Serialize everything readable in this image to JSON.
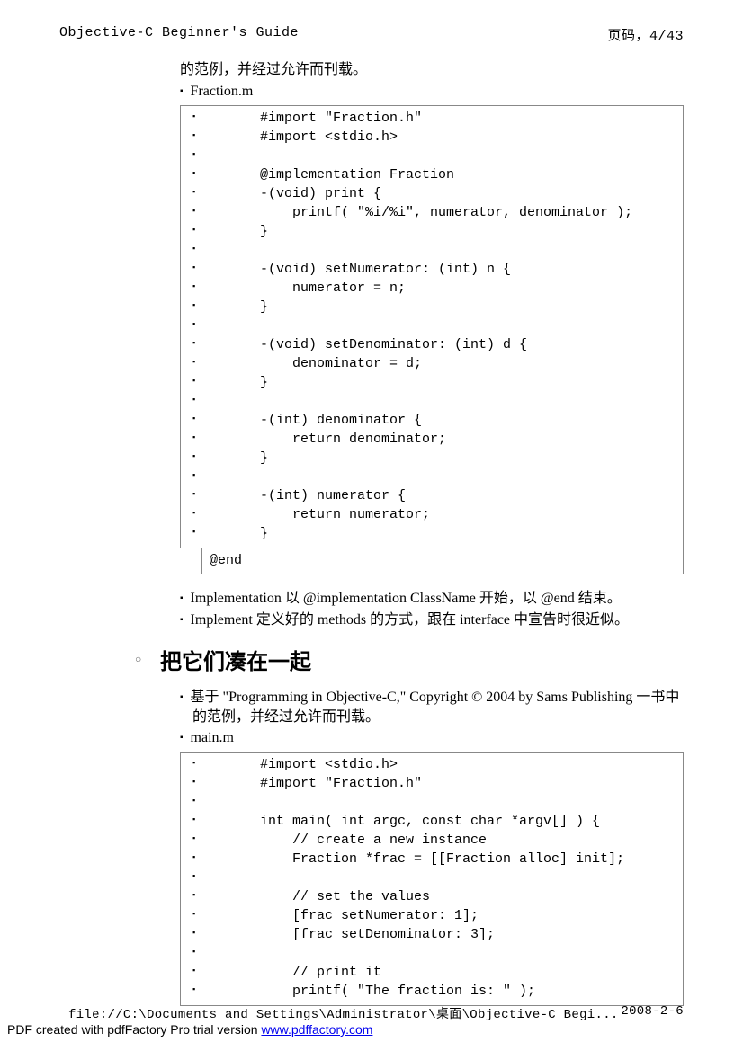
{
  "header": {
    "title": "Objective-C Beginner's Guide",
    "pageinfo": "页码，4/43"
  },
  "intro_para": "的范例，并经过允许而刊载。",
  "file1": "Fraction.m",
  "code1": [
    "#import \"Fraction.h\"",
    "#import <stdio.h>",
    "",
    "@implementation Fraction",
    "-(void) print {",
    "    printf( \"%i/%i\", numerator, denominator );",
    "}",
    "",
    "-(void) setNumerator: (int) n {",
    "    numerator = n;",
    "}",
    "",
    "-(void) setDenominator: (int) d {",
    "    denominator = d;",
    "}",
    "",
    "-(int) denominator {",
    "    return denominator;",
    "}",
    "",
    "-(int) numerator {",
    "    return numerator;",
    "}"
  ],
  "code1_end": "@end",
  "notes": [
    "Implementation 以 @implementation ClassName 开始，以 @end 结束。",
    "Implement 定义好的 methods 的方式，跟在 interface 中宣告时很近似。"
  ],
  "section_title": "把它们凑在一起",
  "section2_intro": "基于 \"Programming in Objective-C,\" Copyright © 2004 by Sams Publishing 一书中的范例，并经过允许而刊载。",
  "file2": "main.m",
  "code2": [
    "#import <stdio.h>",
    "#import \"Fraction.h\"",
    "",
    "int main( int argc, const char *argv[] ) {",
    "    // create a new instance",
    "    Fraction *frac = [[Fraction alloc] init];",
    "",
    "    // set the values",
    "    [frac setNumerator: 1];",
    "    [frac setDenominator: 3];",
    "",
    "    // print it",
    "    printf( \"The fraction is: \" );"
  ],
  "footer": {
    "path": "file://C:\\Documents and Settings\\Administrator\\桌面\\Objective-C Begi...",
    "date": "2008-2-6",
    "pdf_text": "PDF created with pdfFactory Pro trial version ",
    "pdf_link": "www.pdffactory.com"
  }
}
